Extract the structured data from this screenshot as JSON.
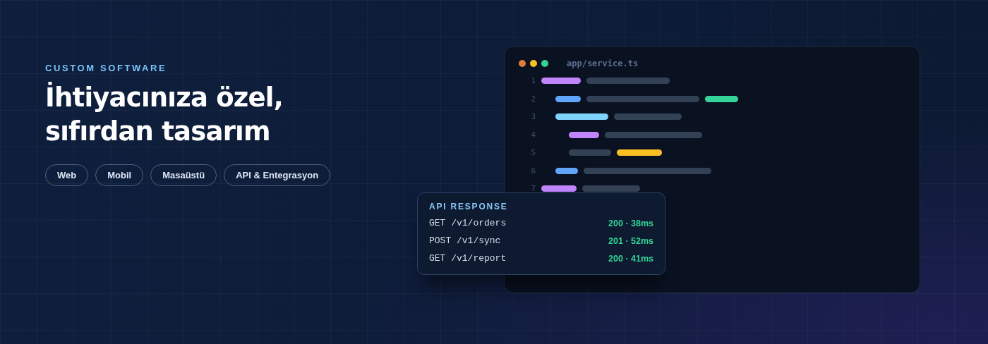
{
  "hero": {
    "eyebrow": "CUSTOM SOFTWARE",
    "headline_lines": [
      "İhtiyacınıza özel,",
      "sıfırdan tasarım"
    ],
    "chips": [
      "Web",
      "Mobil",
      "Masaüstü",
      "API & Entegrasyon"
    ]
  },
  "editor": {
    "dots": [
      {
        "color": "#e07b39"
      },
      {
        "color": "#fbbf24"
      },
      {
        "color": "#34d399"
      }
    ],
    "filename": "app/service.ts",
    "lines": [
      {
        "number": "1",
        "tokens": [
          {
            "color": "#c084fc"
          },
          {
            "color": "#334155"
          }
        ],
        "children": [
          {
            "number": "2",
            "tokens": [
              {
                "color": "#60a5fa"
              },
              {
                "color": "#334155"
              },
              {
                "color": "#34d399"
              }
            ]
          },
          {
            "number": "3",
            "tokens": [
              {
                "color": "#7dd3fc"
              },
              {
                "color": "#334155"
              }
            ],
            "children": [
              {
                "number": "4",
                "tokens": [
                  {
                    "color": "#c084fc"
                  },
                  {
                    "color": "#334155"
                  }
                ]
              },
              {
                "number": "5",
                "tokens": [
                  {
                    "color": "#334155"
                  },
                  {
                    "color": "#fbbf24"
                  }
                ]
              }
            ]
          },
          {
            "number": "6",
            "tokens": [
              {
                "color": "#60a5fa"
              },
              {
                "color": "#334155"
              }
            ]
          }
        ]
      },
      {
        "number": "7",
        "tokens": [
          {
            "color": "#c084fc"
          },
          {
            "color": "#334155"
          }
        ]
      }
    ]
  },
  "api_panel": {
    "title": "API RESPONSE",
    "rows": [
      {
        "request": "GET /v1/orders",
        "result": "200 · 38ms"
      },
      {
        "request": "POST /v1/sync",
        "result": "201 · 52ms"
      },
      {
        "request": "GET /v1/report",
        "result": "200 · 41ms"
      }
    ]
  }
}
